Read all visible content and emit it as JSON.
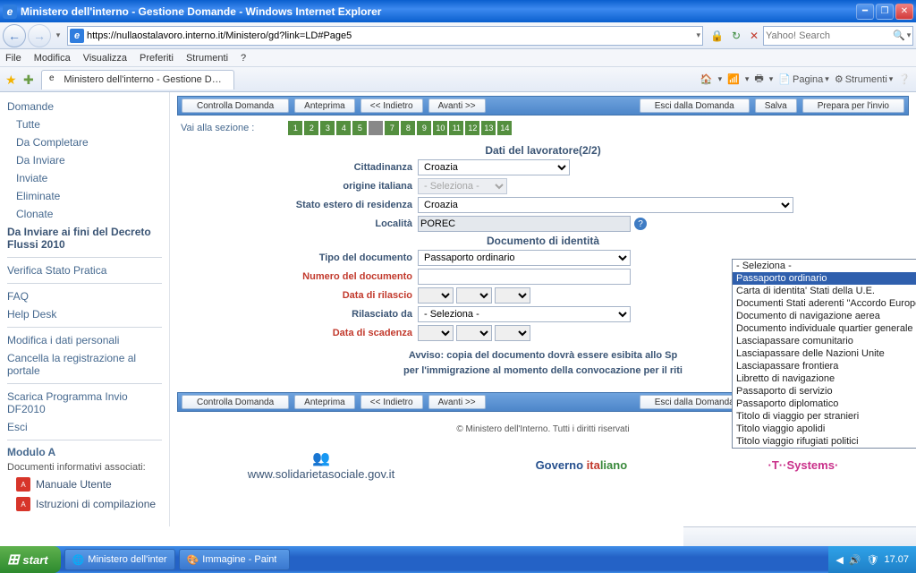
{
  "window": {
    "title": "Ministero dell'interno - Gestione Domande - Windows Internet Explorer"
  },
  "addressbar": {
    "url": "https://nullaostalavoro.interno.it/Ministero/gd?link=LD#Page5"
  },
  "search": {
    "placeholder": "Yahoo! Search"
  },
  "menubar": [
    "File",
    "Modifica",
    "Visualizza",
    "Preferiti",
    "Strumenti",
    "?"
  ],
  "tab": {
    "label": "Ministero dell'interno - Gestione Domande"
  },
  "cmdbar": {
    "page": "Pagina",
    "tools": "Strumenti"
  },
  "sidebar": {
    "group1": [
      "Domande",
      "Tutte",
      "Da Completare",
      "Da Inviare",
      "Inviate",
      "Eliminate",
      "Clonate"
    ],
    "bold1": "Da Inviare ai fini del Decreto Flussi 2010",
    "link_verifica": "Verifica Stato Pratica",
    "group2": [
      "FAQ",
      "Help Desk"
    ],
    "group3": [
      "Modifica i dati personali",
      "Cancella la registrazione al portale"
    ],
    "group4": [
      "Scarica Programma Invio DF2010",
      "Esci"
    ],
    "mod_title": "Modulo A",
    "docs_label": "Documenti informativi associati:",
    "doc1": "Manuale Utente",
    "doc2": "Istruzioni di compilazione"
  },
  "toolbar": {
    "controlla": "Controlla Domanda",
    "anteprima": "Anteprima",
    "indietro": "<< Indietro",
    "avanti": "Avanti >>",
    "esci": "Esci dalla Domanda",
    "salva": "Salva",
    "prepara": "Prepara per l'invio"
  },
  "section_nav": {
    "label": "Vai alla sezione :",
    "pages": [
      "1",
      "2",
      "3",
      "4",
      "5",
      "",
      "7",
      "8",
      "9",
      "10",
      "11",
      "12",
      "13",
      "14"
    ]
  },
  "form": {
    "h1": "Dati del lavoratore(2/2)",
    "fields": {
      "cittadinanza": {
        "label": "Cittadinanza",
        "value": "Croazia"
      },
      "origine": {
        "label": "origine italiana",
        "value": "- Seleziona -"
      },
      "stato_estero": {
        "label": "Stato estero di residenza",
        "value": "Croazia"
      },
      "localita": {
        "label": "Località",
        "value": "POREC"
      }
    },
    "h2": "Documento di identità",
    "doc_fields": {
      "tipo": {
        "label": "Tipo del documento",
        "value": "Passaporto ordinario"
      },
      "numero": {
        "label": "Numero del documento",
        "value": ""
      },
      "rilascio": {
        "label": "Data di rilascio"
      },
      "rilasciato_da": {
        "label": "Rilasciato da",
        "value": "- Seleziona -"
      },
      "scadenza": {
        "label": "Data di scadenza"
      }
    },
    "avviso_l1": "Avviso: copia del documento dovrà essere esibita allo Sp",
    "avviso_l2": "per l'immigrazione al momento della convocazione per il riti"
  },
  "dropdown": {
    "options": [
      "- Seleziona -",
      "Passaporto ordinario",
      "Carta di identita' Stati della U.E.",
      "Documenti Stati aderenti \"Accordo Europeo sull'abolizione del passaporto\"",
      "Documento di navigazione aerea",
      "Documento individuale quartier generale NATO",
      "Lasciapassare comunitario",
      "Lasciapassare delle Nazioni Unite",
      "Lasciapassare frontiera",
      "Libretto di navigazione",
      "Passaporto di servizio",
      "Passaporto diplomatico",
      "Titolo di viaggio per stranieri",
      "Titolo viaggio apolidi",
      "Titolo viaggio rifugiati politici"
    ],
    "highlighted_index": 1
  },
  "footer": {
    "copyright": "© Ministero dell'Interno. Tutti i diritti riservati",
    "solid": "www.solidarietasociale.gov.it",
    "gov_a": "Governo ",
    "gov_b": "ita",
    "gov_c": "liano",
    "tsys": "·T··Systems·"
  },
  "taskbar": {
    "start": "start",
    "t1": "Ministero dell'interno ...",
    "t2": "Immagine - Paint",
    "clock": "17.07"
  }
}
